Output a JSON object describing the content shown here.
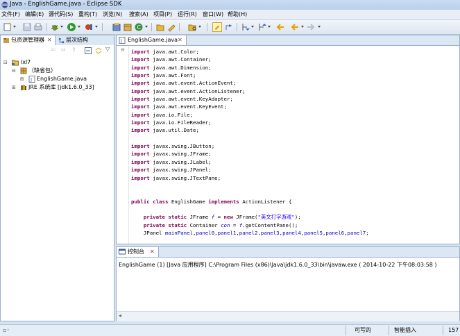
{
  "window": {
    "title": "Java - EnglishGame.java - Eclipse SDK"
  },
  "menubar": {
    "items": [
      {
        "label": "文件(F)"
      },
      {
        "label": "编辑(E)"
      },
      {
        "label": "源代码(S)"
      },
      {
        "label": "重构(T)"
      },
      {
        "label": "浏览(N)"
      },
      {
        "label": "搜索(A)"
      },
      {
        "label": "项目(P)"
      },
      {
        "label": "运行(R)"
      },
      {
        "label": "窗口(W)"
      },
      {
        "label": "帮助(H)"
      }
    ]
  },
  "left_panel": {
    "tabs": [
      {
        "label": "包资源管理器"
      },
      {
        "label": "层次结构"
      }
    ],
    "tree": [
      {
        "label": "lxl7"
      },
      {
        "label": "（缺省包）"
      },
      {
        "label": "EnglishGame.java"
      },
      {
        "label": "JRE 系统库 [jdk1.6.0_33]"
      }
    ]
  },
  "editor": {
    "tab_label": "EnglishGame.java",
    "code_lines": [
      "import java.awt.Color;",
      "import java.awt.Container;",
      "import java.awt.Dimension;",
      "import java.awt.Font;",
      "import java.awt.event.ActionEvent;",
      "import java.awt.event.ActionListener;",
      "import java.awt.event.KeyAdapter;",
      "import java.awt.event.KeyEvent;",
      "import java.io.File;",
      "import java.io.FileReader;",
      "import java.util.Date;",
      "",
      "import javax.swing.JButton;",
      "import javax.swing.JFrame;",
      "import javax.swing.JLabel;",
      "import javax.swing.JPanel;",
      "import javax.swing.JTextPane;",
      "",
      "",
      "public class EnglishGame implements ActionListener {",
      "",
      "    private static JFrame f = new JFrame(\"英文打字游戏\");",
      "    private static Container con = f.getContentPane();",
      "    JPanel mainPanel,panel0,panel1,panel2,panel3,panel4,panel5,panel6,panel7;"
    ]
  },
  "console": {
    "tab_label": "控制台",
    "text": "EnglishGame (1) [Java 应用程序] C:\\Program Files (x86)\\Java\\jdk1.6.0_33\\bin\\javaw.exe ( 2014-10-22 下午08:03:58 )"
  },
  "statusbar": {
    "writable": "可写的",
    "insert_mode": "智能插入",
    "position": "157"
  },
  "colors": {
    "keyword": "#7f0055",
    "field": "#0000c0",
    "string": "#2a00ff",
    "accent": "#99aecb"
  }
}
